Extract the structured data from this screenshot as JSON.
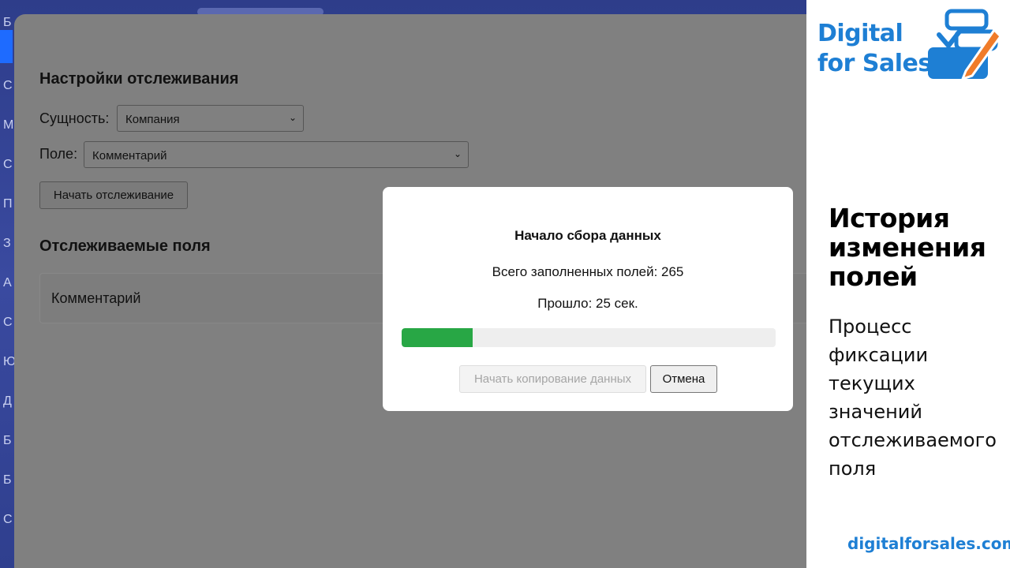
{
  "sidebar": {
    "letters": [
      "Б",
      "С",
      "М",
      "С",
      "П",
      "З",
      "А",
      "С",
      "Ю",
      "Д",
      "Б",
      "Б",
      "С"
    ]
  },
  "settings": {
    "heading": "Настройки отслеживания",
    "entity_label": "Сущность:",
    "entity_value": "Компания",
    "field_label": "Поле:",
    "field_value": "Комментарий",
    "start_button": "Начать отслеживание"
  },
  "tracked": {
    "heading": "Отслеживаемые поля",
    "items": [
      "Комментарий"
    ]
  },
  "modal": {
    "title": "Начало сбора данных",
    "total_text": "Всего заполненных полей: 265",
    "elapsed_text": "Прошло: 25 сек.",
    "progress_percent": 19,
    "copy_button": "Начать копирование данных",
    "cancel_button": "Отмена"
  },
  "promo": {
    "brand_line1": "Digital",
    "brand_line2": "for Sales",
    "title_lines": [
      "История",
      "изменения",
      "полей"
    ],
    "desc_lines": [
      "Процесс",
      "фиксации",
      "текущих",
      "значений",
      "отслеживаемого",
      "поля"
    ],
    "website": "digitalforsales.com",
    "accent_color": "#1e7fd4",
    "logo_accent": "#f07c2a"
  }
}
